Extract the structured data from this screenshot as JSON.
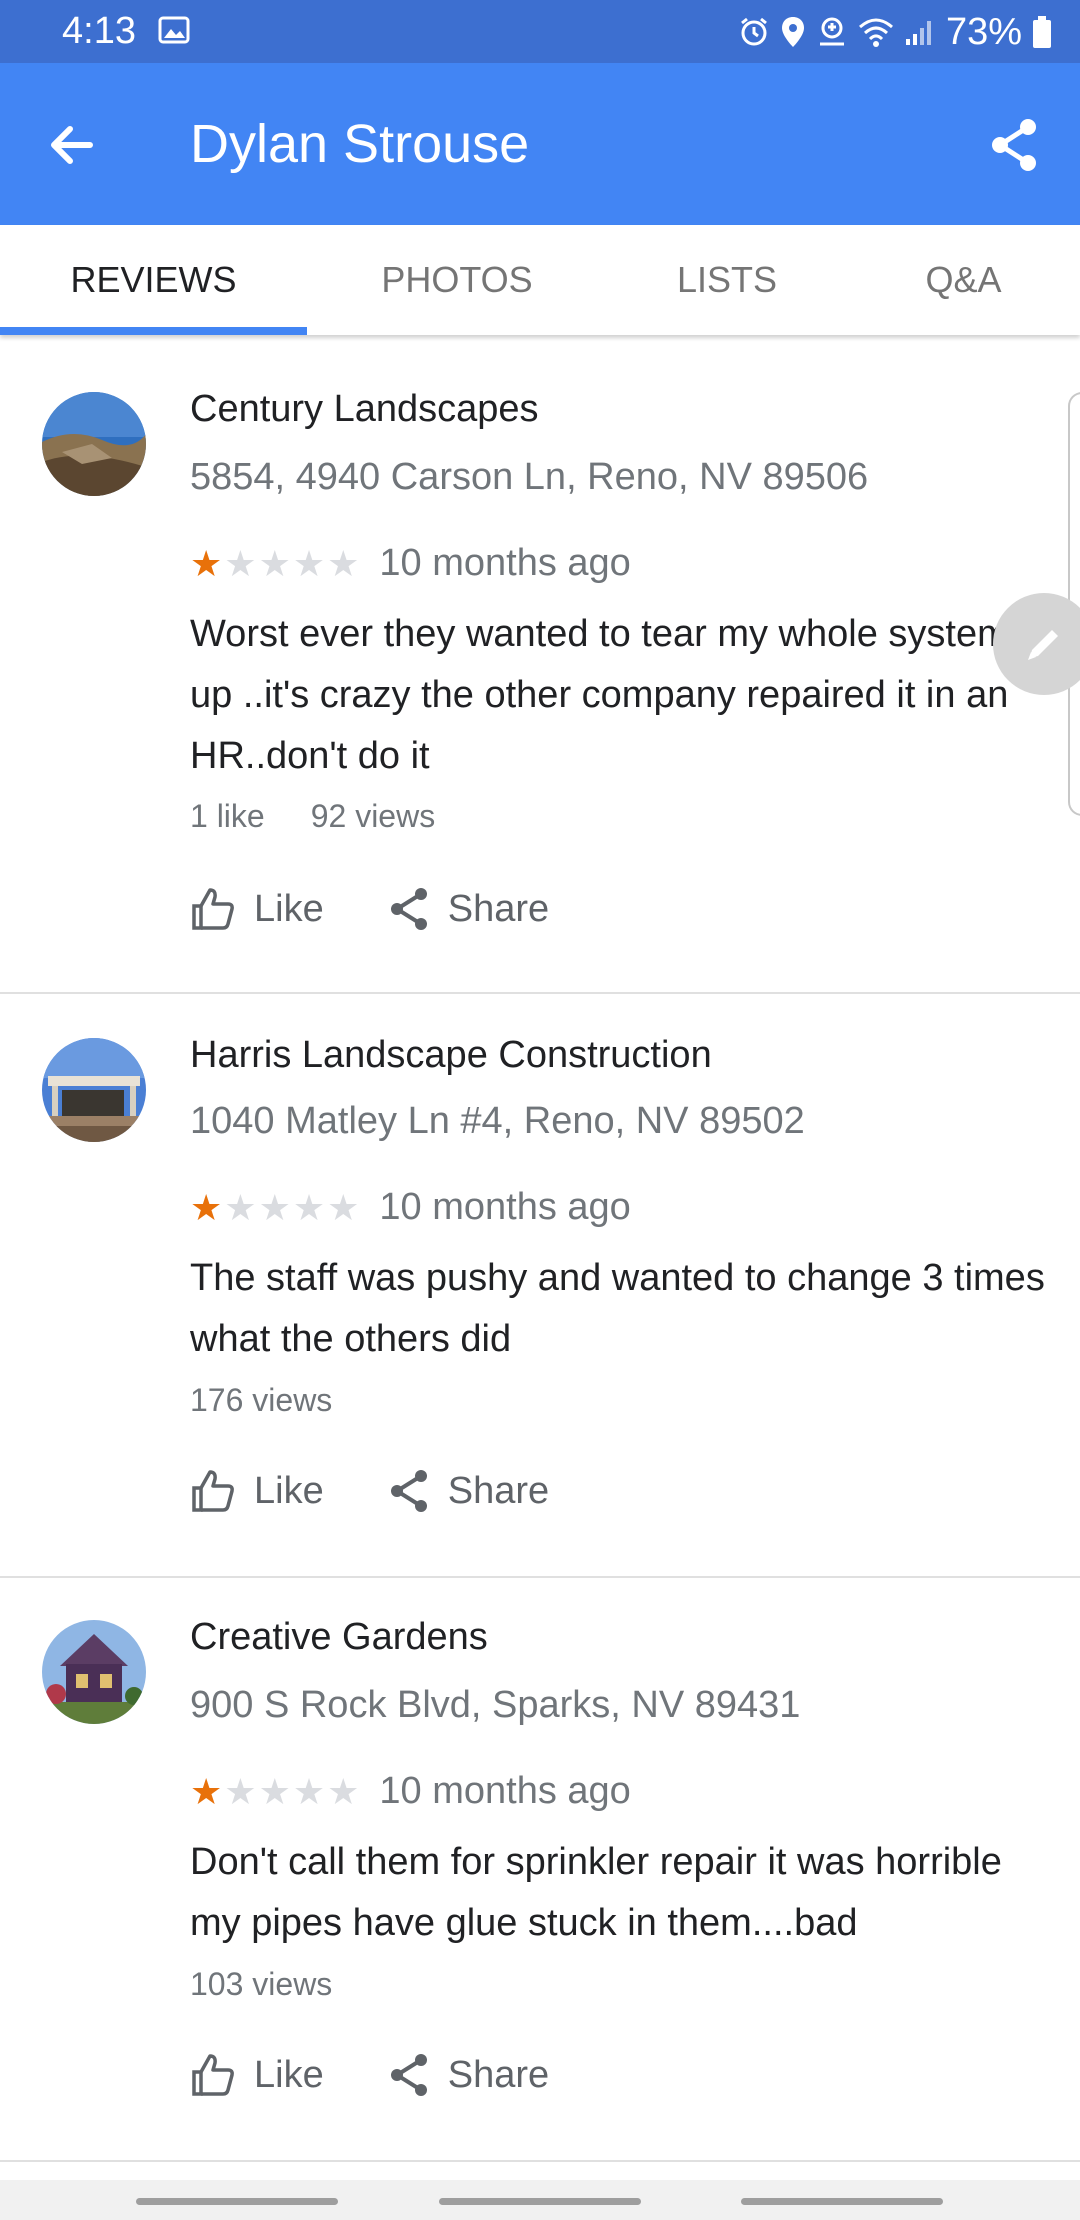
{
  "status_bar": {
    "time": "4:13",
    "battery": "73%"
  },
  "app_bar": {
    "title": "Dylan Strouse"
  },
  "tabs": [
    {
      "label": "REVIEWS",
      "active": true
    },
    {
      "label": "PHOTOS",
      "active": false
    },
    {
      "label": "LISTS",
      "active": false
    },
    {
      "label": "Q&A",
      "active": false
    }
  ],
  "reviews": [
    {
      "name": "Century Landscapes",
      "address": "5854, 4940 Carson Ln, Reno, NV 89506",
      "rating": 1,
      "rating_max": 5,
      "date": "10 months ago",
      "text": "Worst ever they wanted to tear my whole system up ..it's crazy the other company repaired it in an HR..don't do it",
      "likes": "1 like",
      "views": "92 views",
      "like_label": "Like",
      "share_label": "Share"
    },
    {
      "name": "Harris Landscape Construction",
      "address": "1040 Matley Ln #4, Reno, NV 89502",
      "rating": 1,
      "rating_max": 5,
      "date": "10 months ago",
      "text": "The staff was pushy and wanted to change 3 times what the others did",
      "views": "176 views",
      "like_label": "Like",
      "share_label": "Share"
    },
    {
      "name": "Creative Gardens",
      "address": "900 S Rock Blvd, Sparks, NV 89431",
      "rating": 1,
      "rating_max": 5,
      "date": "10 months ago",
      "text": "Don't call them for sprinkler repair it was horrible my pipes have glue stuck in them....bad",
      "views": "103 views",
      "like_label": "Like",
      "share_label": "Share"
    }
  ],
  "icons": {
    "back": "arrow-left-icon",
    "share": "share-icon",
    "like": "thumbs-up-icon",
    "edit": "pencil-icon",
    "star": "star-icon"
  },
  "colors": {
    "status_bar": "#3d6fd0",
    "app_bar": "#4285f4",
    "star_filled": "#e8710a",
    "star_empty": "#dadce0"
  }
}
